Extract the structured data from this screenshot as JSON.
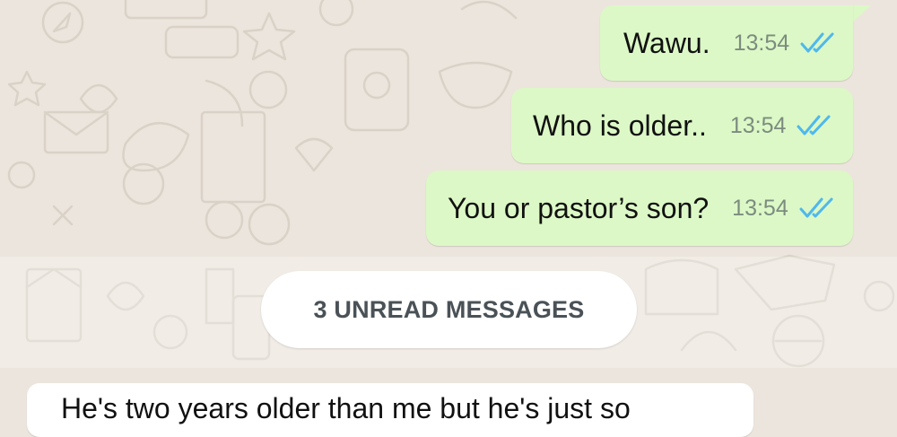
{
  "messages_outgoing": [
    {
      "text": "Wawu.",
      "time": "13:54",
      "status_icon": "double-check-read-icon"
    },
    {
      "text": "Who is older..",
      "time": "13:54",
      "status_icon": "double-check-read-icon"
    },
    {
      "text": "You or pastor’s son?",
      "time": "13:54",
      "status_icon": "double-check-read-icon"
    }
  ],
  "unread_divider": {
    "label": "3 UNREAD MESSAGES"
  },
  "messages_incoming": [
    {
      "text": "He's two years older than me but he's just so"
    }
  ],
  "colors": {
    "wallpaper": "#ece5dd",
    "outgoing_bubble": "#dcf8c6",
    "incoming_bubble": "#ffffff",
    "tick_read": "#4fb8ec",
    "timestamp": "#7c8c7f"
  }
}
